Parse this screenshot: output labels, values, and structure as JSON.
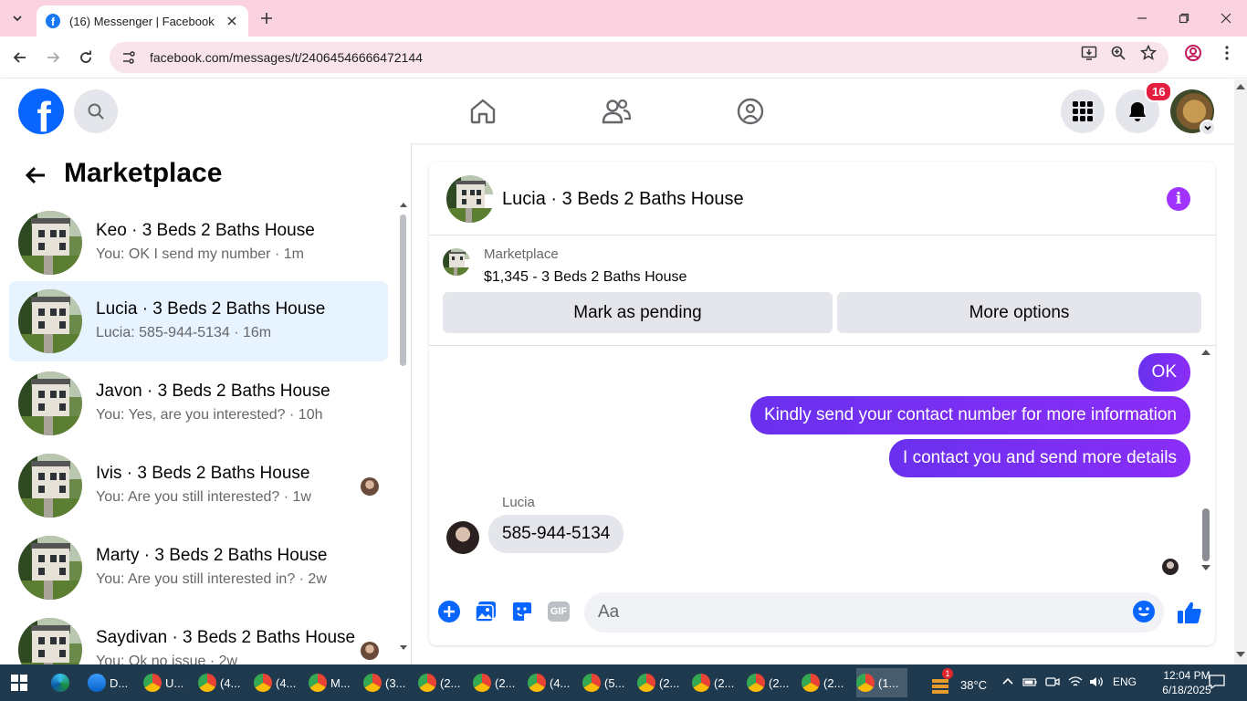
{
  "browser": {
    "tab_title": "(16) Messenger | Facebook",
    "url": "facebook.com/messages/t/24064546666472144"
  },
  "header": {
    "notification_count": "16"
  },
  "sidebar": {
    "title": "Marketplace",
    "conversations": [
      {
        "name": "Keo · 3 Beds 2 Baths House",
        "preview": "You: OK I send my number · 1m",
        "active": false
      },
      {
        "name": "Lucia · 3 Beds 2 Baths House",
        "preview": "Lucia: 585-944-5134 · 16m",
        "active": true
      },
      {
        "name": "Javon · 3 Beds 2 Baths House",
        "preview": "You: Yes, are you interested? · 10h",
        "active": false
      },
      {
        "name": "Ivis · 3 Beds 2 Baths House",
        "preview": "You: Are you still interested? · 1w",
        "active": false
      },
      {
        "name": "Marty · 3 Beds 2 Baths House",
        "preview": "You: Are you still interested in? · 2w",
        "active": false
      },
      {
        "name": "Saydivan · 3 Beds 2 Baths House",
        "preview": "You: Ok no issue · 2w",
        "active": false
      }
    ]
  },
  "chat": {
    "title": "Lucia · 3 Beds 2 Baths House",
    "marketplace_label": "Marketplace",
    "listing": "$1,345 - 3 Beds 2 Baths House",
    "mark_pending": "Mark as pending",
    "more_options": "More options",
    "outgoing": [
      "OK",
      "Kindly send your contact number for more information",
      "I contact you and send more details"
    ],
    "sender_name": "Lucia",
    "incoming": "585-944-5134",
    "composer_placeholder": "Aa"
  },
  "taskbar": {
    "items": [
      "D...",
      "U...",
      "(4...",
      "(4...",
      "M...",
      "(3...",
      "(2...",
      "(2...",
      "(4...",
      "(5...",
      "(2...",
      "(2...",
      "(2...",
      "(2...",
      "(1..."
    ],
    "weather": "38°C",
    "lang": "ENG",
    "time": "12:04 PM",
    "date": "6/18/2025",
    "weather_badge": "1"
  },
  "colors": {
    "accent": "#7b2ff7",
    "fb_blue": "#0866ff",
    "active_row": "#e7f3ff"
  }
}
